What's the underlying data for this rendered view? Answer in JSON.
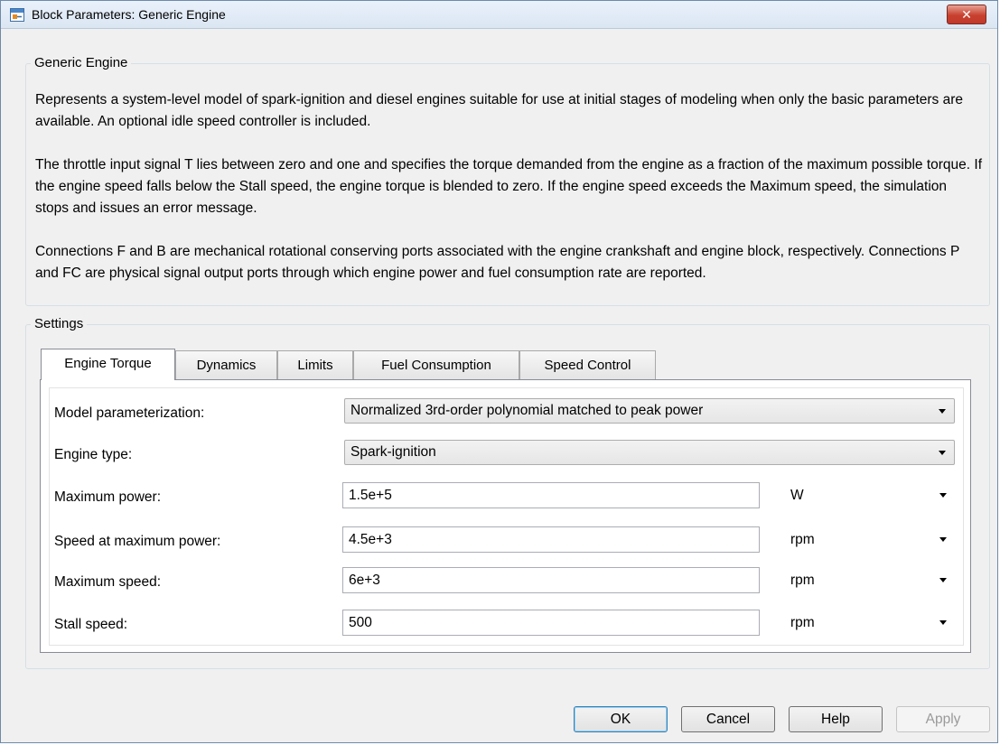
{
  "window": {
    "title": "Block Parameters: Generic Engine",
    "icon": "simulink-block-icon",
    "close_label": "✕"
  },
  "block": {
    "name": "Generic Engine",
    "description": [
      "Represents a system-level model of spark-ignition and diesel engines suitable for use at initial stages of modeling when only the basic parameters are available. An optional idle speed controller is included.",
      "The throttle input signal T lies between zero and one and specifies the torque demanded from the engine as a fraction of the maximum possible torque. If the engine speed falls below the Stall speed, the engine torque is blended to zero. If the engine speed exceeds the Maximum speed, the simulation stops and issues an error message.",
      "Connections F and B are mechanical rotational conserving ports associated with the engine crankshaft and engine block, respectively. Connections P and FC are physical signal output ports through which engine power and fuel consumption rate are reported."
    ]
  },
  "settings": {
    "label": "Settings",
    "tabs": [
      {
        "label": "Engine Torque",
        "active": true
      },
      {
        "label": "Dynamics",
        "active": false
      },
      {
        "label": "Limits",
        "active": false
      },
      {
        "label": "Fuel Consumption",
        "active": false
      },
      {
        "label": "Speed Control",
        "active": false
      }
    ],
    "params": {
      "model_parameterization": {
        "label": "Model parameterization:",
        "value": "Normalized 3rd-order polynomial matched to peak power"
      },
      "engine_type": {
        "label": "Engine type:",
        "value": "Spark-ignition"
      },
      "maximum_power": {
        "label": "Maximum power:",
        "value": "1.5e+5",
        "unit": "W"
      },
      "speed_at_max_power": {
        "label": "Speed at maximum power:",
        "value": "4.5e+3",
        "unit": "rpm"
      },
      "maximum_speed": {
        "label": "Maximum speed:",
        "value": "6e+3",
        "unit": "rpm"
      },
      "stall_speed": {
        "label": "Stall speed:",
        "value": "500",
        "unit": "rpm"
      }
    }
  },
  "buttons": {
    "ok": "OK",
    "cancel": "Cancel",
    "help": "Help",
    "apply": "Apply"
  },
  "colors": {
    "close_button": "#c8412f",
    "default_button_border": "#3c7fb1",
    "disabled_text": "#9a9a9a"
  }
}
